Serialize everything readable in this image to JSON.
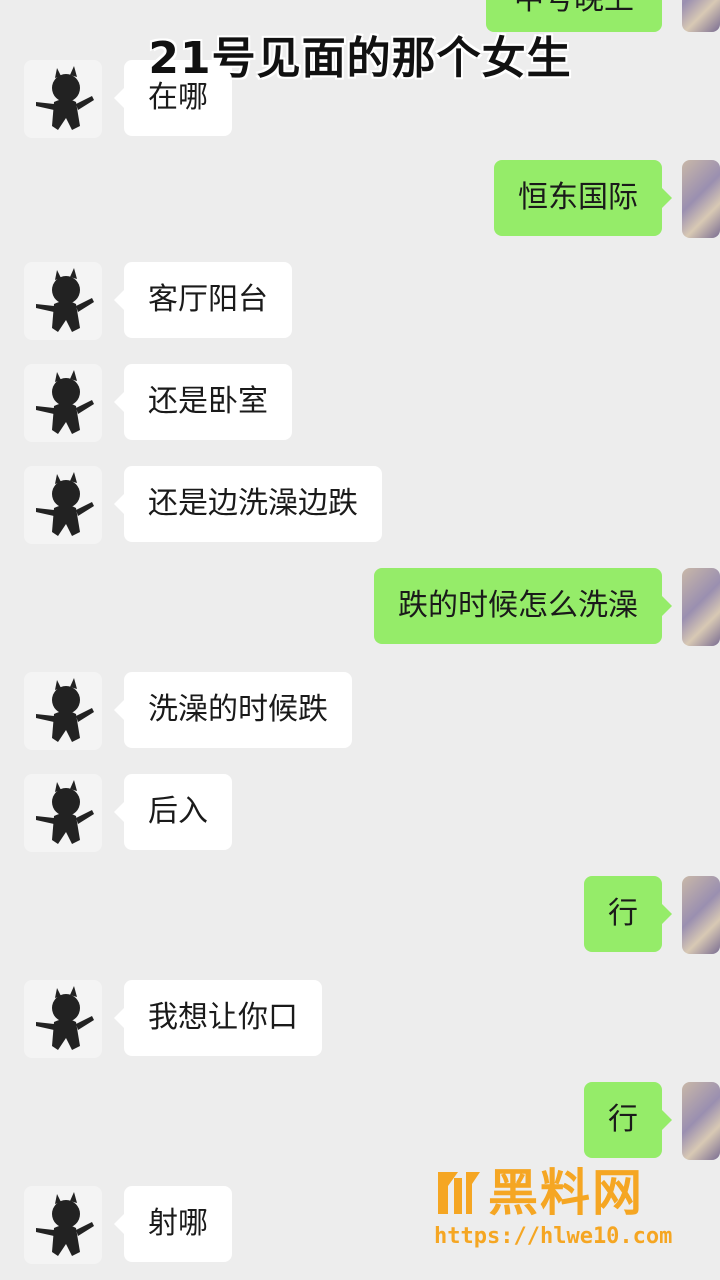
{
  "caption": "21号见面的那个女生",
  "partial_top_text": "中号晚上",
  "messages": [
    {
      "side": "in",
      "text": "在哪"
    },
    {
      "side": "out",
      "text": "恒东国际"
    },
    {
      "side": "in",
      "text": "客厅阳台"
    },
    {
      "side": "in",
      "text": "还是卧室"
    },
    {
      "side": "in",
      "text": "还是边洗澡边跌"
    },
    {
      "side": "out",
      "text": "跌的时候怎么洗澡"
    },
    {
      "side": "in",
      "text": "洗澡的时候跌"
    },
    {
      "side": "in",
      "text": "后入"
    },
    {
      "side": "out",
      "text": "行"
    },
    {
      "side": "in",
      "text": "我想让你口"
    },
    {
      "side": "out",
      "text": "行"
    },
    {
      "side": "in",
      "text": "射哪"
    }
  ],
  "watermark": {
    "title": "黑料网",
    "url": "https://hlwe10.com"
  },
  "colors": {
    "background": "#ededed",
    "incoming_bubble": "#ffffff",
    "outgoing_bubble": "#95ec69",
    "watermark": "#f5a623"
  }
}
